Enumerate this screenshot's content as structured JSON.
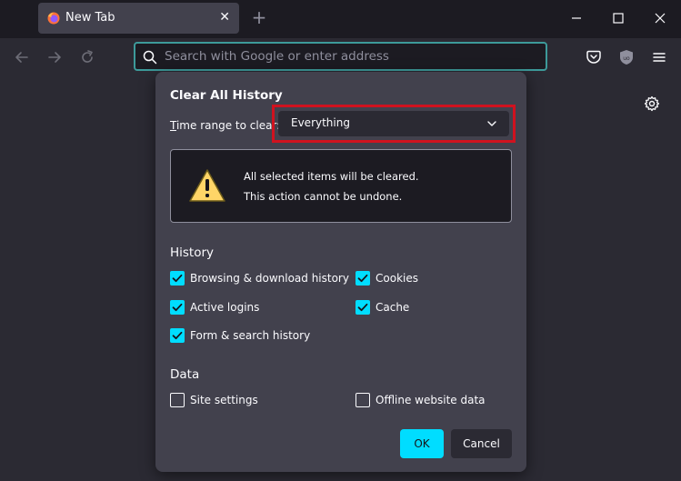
{
  "tab": {
    "title": "New Tab",
    "close_glyph": "✕",
    "favicon": "firefox-icon"
  },
  "new_tab_glyph": "+",
  "window_controls": [
    "minimize-icon",
    "maximize-icon",
    "close-icon"
  ],
  "nav": {
    "buttons": [
      "back-arrow-icon",
      "forward-arrow-icon",
      "reload-icon"
    ],
    "urlbar_placeholder": "Search with Google or enter address",
    "tools": [
      "pocket-icon",
      "ublock-shield-icon",
      "hamburger-menu-icon"
    ]
  },
  "content": {
    "settings_icon": "gear-icon"
  },
  "dialog": {
    "title": "Clear All History",
    "range_label_prefix": "T",
    "range_label_rest": "ime range to clear:",
    "range_value": "Everything",
    "warning_line1": "All selected items will be cleared.",
    "warning_line2": "This action cannot be undone.",
    "history_title": "History",
    "history_items": [
      {
        "label": "Browsing & download history",
        "checked": true
      },
      {
        "label": "Cookies",
        "checked": true
      },
      {
        "label": "Active logins",
        "checked": true
      },
      {
        "label": "Cache",
        "checked": true
      },
      {
        "label": "Form & search history",
        "checked": true
      }
    ],
    "data_title": "Data",
    "data_items": [
      {
        "label": "Site settings",
        "checked": false
      },
      {
        "label": "Offline website data",
        "checked": false
      }
    ],
    "ok_label": "OK",
    "cancel_label": "Cancel"
  },
  "colors": {
    "accent": "#00ddff",
    "highlight_border": "#d0121f",
    "dialog_bg": "#42414d",
    "toolbar_bg": "#2b2a33"
  }
}
